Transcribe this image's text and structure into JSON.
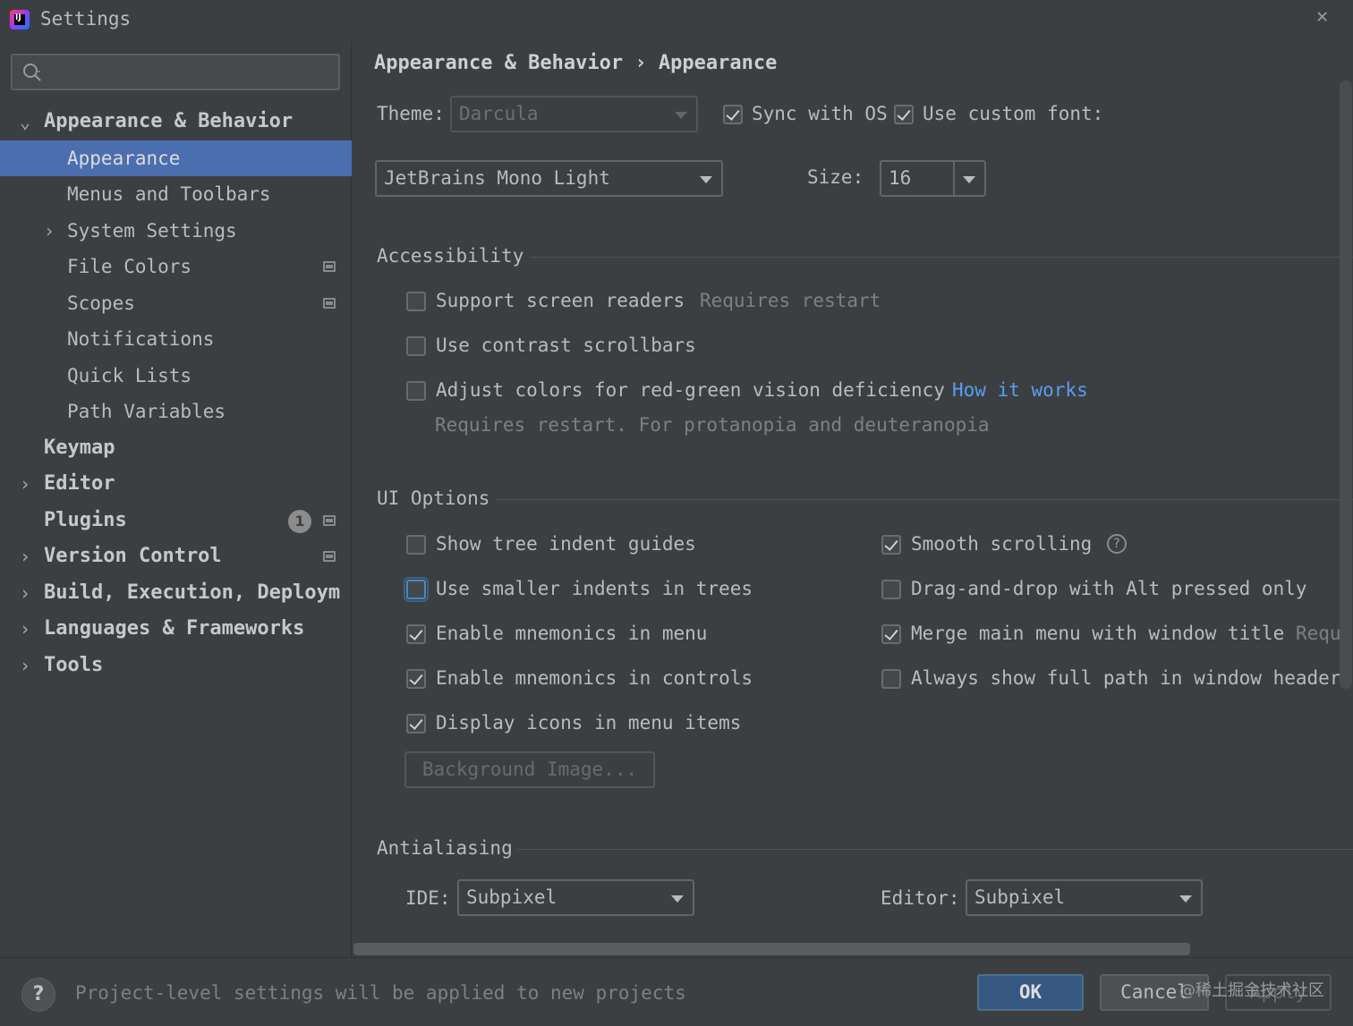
{
  "window": {
    "title": "Settings",
    "close_glyph": "✕"
  },
  "sidebar": {
    "search_placeholder": "",
    "items": [
      {
        "label": "Appearance & Behavior",
        "level": 0,
        "arrow": "⌄",
        "expanded": true
      },
      {
        "label": "Appearance",
        "level": 1,
        "selected": true
      },
      {
        "label": "Menus and Toolbars",
        "level": 1
      },
      {
        "label": "System Settings",
        "level": 1,
        "arrow": "›"
      },
      {
        "label": "File Colors",
        "level": 1,
        "project_icon": true
      },
      {
        "label": "Scopes",
        "level": 1,
        "project_icon": true
      },
      {
        "label": "Notifications",
        "level": 1
      },
      {
        "label": "Quick Lists",
        "level": 1
      },
      {
        "label": "Path Variables",
        "level": 1
      },
      {
        "label": "Keymap",
        "level": 0
      },
      {
        "label": "Editor",
        "level": 0,
        "arrow": "›"
      },
      {
        "label": "Plugins",
        "level": 0,
        "count": "1",
        "project_icon": true
      },
      {
        "label": "Version Control",
        "level": 0,
        "arrow": "›",
        "project_icon": true
      },
      {
        "label": "Build, Execution, Deploym",
        "level": 0,
        "arrow": "›"
      },
      {
        "label": "Languages & Frameworks",
        "level": 0,
        "arrow": "›"
      },
      {
        "label": "Tools",
        "level": 0,
        "arrow": "›"
      }
    ]
  },
  "main": {
    "breadcrumb": "Appearance & Behavior › Appearance",
    "theme": {
      "label": "Theme:",
      "value": "Darcula",
      "sync_label": "Sync with OS",
      "sync_checked": true,
      "custom_font_label": "Use custom font:",
      "custom_font_checked": true
    },
    "font": {
      "value": "JetBrains Mono Light",
      "size_label": "Size:",
      "size_value": "16"
    },
    "accessibility": {
      "title": "Accessibility",
      "screen_readers": "Support screen readers",
      "screen_readers_hint": "Requires restart",
      "contrast_scrollbars": "Use contrast scrollbars",
      "adjust_colors": "Adjust colors for red-green vision deficiency",
      "how_it_works": "How it works",
      "adjust_colors_hint": "Requires restart. For protanopia and deuteranopia"
    },
    "ui_options": {
      "title": "UI Options",
      "left": [
        {
          "label": "Show tree indent guides",
          "checked": false
        },
        {
          "label": "Use smaller indents in trees",
          "checked": false,
          "focused": true
        },
        {
          "label": "Enable mnemonics in menu",
          "checked": true
        },
        {
          "label": "Enable mnemonics in controls",
          "checked": true
        },
        {
          "label": "Display icons in menu items",
          "checked": true
        }
      ],
      "right": [
        {
          "label": "Smooth scrolling",
          "checked": true,
          "help": true
        },
        {
          "label": "Drag-and-drop with Alt pressed only",
          "checked": false
        },
        {
          "label": "Merge main menu with window title",
          "checked": true,
          "hint": "Requi"
        },
        {
          "label": "Always show full path in window header",
          "checked": false
        }
      ],
      "background_image": "Background Image..."
    },
    "antialiasing": {
      "title": "Antialiasing",
      "ide_label": "IDE:",
      "ide_value": "Subpixel",
      "editor_label": "Editor:",
      "editor_value": "Subpixel"
    }
  },
  "footer": {
    "help_glyph": "?",
    "message": "Project-level settings will be applied to new projects",
    "ok": "OK",
    "cancel": "Cancel",
    "apply": "Apply",
    "watermark": "@稀土掘金技术社区"
  },
  "colors": {
    "background": "#3c3f41",
    "selection": "#4b6eaf",
    "link": "#589df6",
    "primary_button": "#365880"
  }
}
